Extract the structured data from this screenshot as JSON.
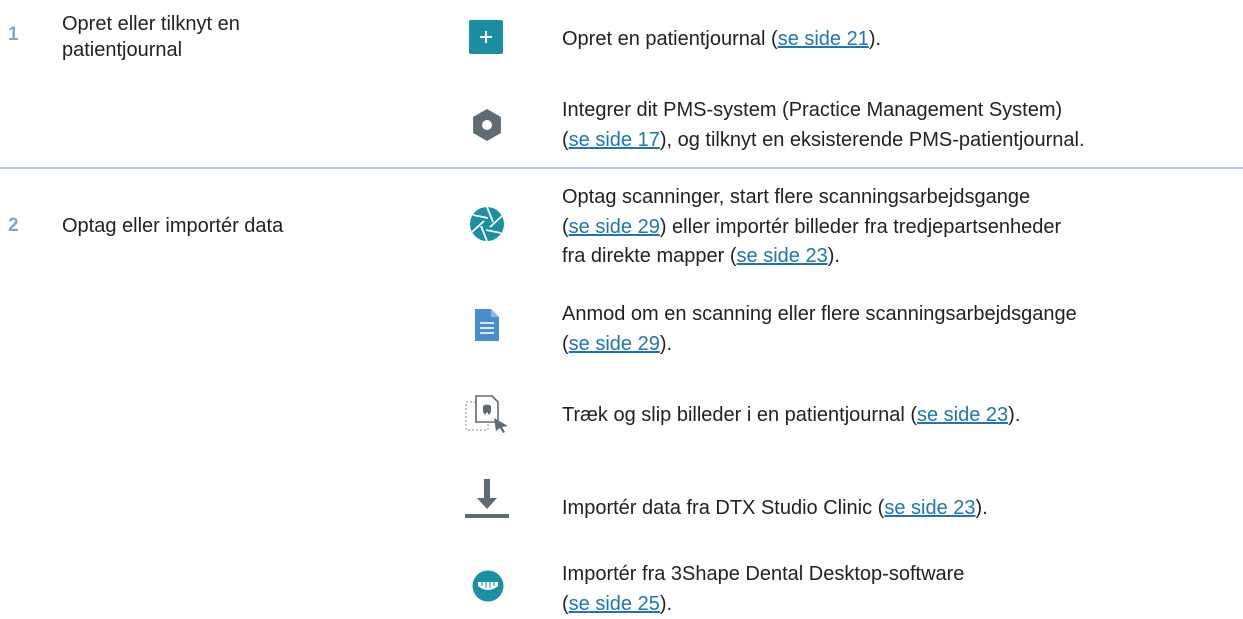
{
  "steps": [
    {
      "number": "1",
      "label": "Opret eller tilknyt en patientjournal"
    },
    {
      "number": "2",
      "label": "Optag eller importér data"
    }
  ],
  "actions": [
    {
      "icon": "plus-icon",
      "before": "Opret en patientjournal (",
      "link": "se side 21",
      "after": ")."
    },
    {
      "icon": "gear-icon",
      "line1": "Integrer dit PMS-system (Practice Management System)",
      "before": "(",
      "link": "se side 17",
      "after": "), og tilknyt en eksisterende PMS-patientjournal."
    },
    {
      "icon": "camera-aperture-icon",
      "line1": "Optag scanninger, start flere scanningsarbejdsgange",
      "before": "(",
      "link": "se side 29",
      "middle": ") eller importér billeder fra tredjepartsenheder",
      "line3_before": "fra direkte mapper (",
      "link2": "se side 23",
      "after": ")."
    },
    {
      "icon": "document-icon",
      "line1": "Anmod om en scanning eller flere scanningsarbejdsgange",
      "before": "(",
      "link": "se side 29",
      "after": ")."
    },
    {
      "icon": "drag-drop-icon",
      "before": "Træk og slip billeder i en patientjournal (",
      "link": "se side 23",
      "after": ")."
    },
    {
      "icon": "download-icon",
      "before": "Importér data fra DTX Studio Clinic (",
      "link": "se side 23",
      "after": ")."
    },
    {
      "icon": "3shape-icon",
      "line1": "Importér fra 3Shape Dental Desktop-software",
      "before": "(",
      "link": "se side 25",
      "after": ")."
    }
  ],
  "colors": {
    "teal": "#1b8fa3",
    "gray_icon": "#5f6b73",
    "doc_blue": "#4a8ccc",
    "link": "#1f74b5",
    "rule": "#b5c6dd",
    "number": "#8aa4c4"
  }
}
